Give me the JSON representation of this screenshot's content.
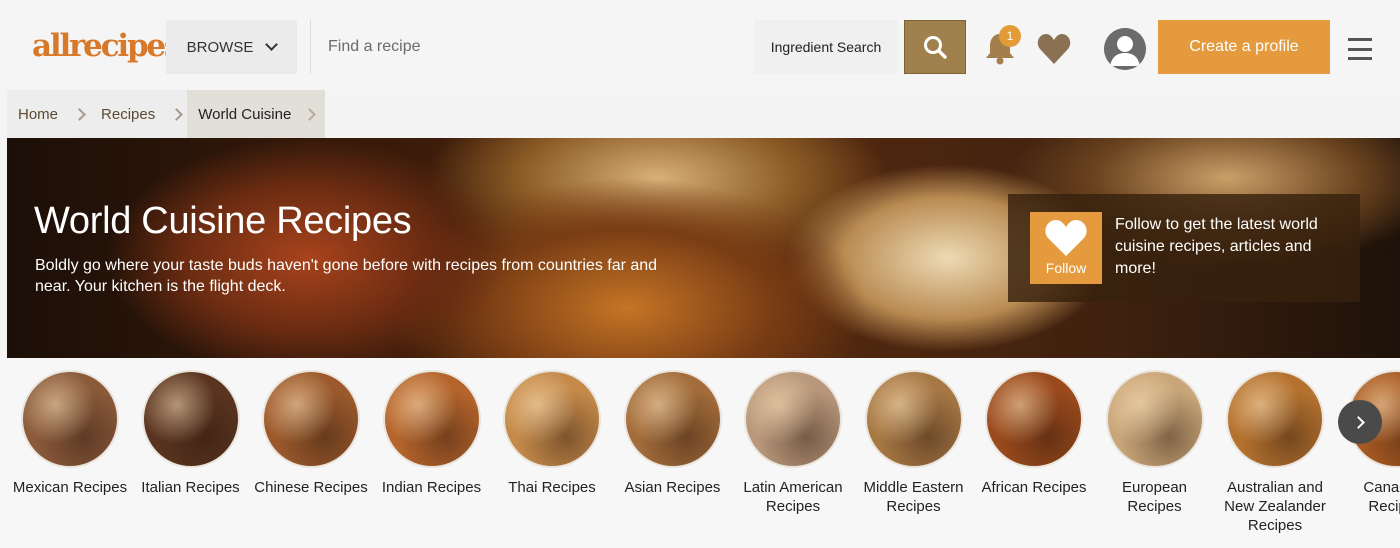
{
  "header": {
    "logo_text": "allrecipes",
    "browse_label": "BROWSE",
    "search_placeholder": "Find a recipe",
    "ingredient_search_label": "Ingredient Search",
    "notification_count": "1",
    "create_profile_label": "Create a profile",
    "brand_color": "#e49a3d"
  },
  "breadcrumb": [
    {
      "label": "Home"
    },
    {
      "label": "Recipes"
    },
    {
      "label": "World Cuisine"
    }
  ],
  "hero": {
    "title": "World Cuisine Recipes",
    "description": "Boldly go where your taste buds haven't gone before with recipes from countries far and near. Your kitchen is the flight deck.",
    "follow_label": "Follow",
    "follow_text": "Follow to get the latest world cuisine recipes, articles and more!"
  },
  "categories": [
    {
      "label": "Mexican Recipes",
      "color": "#8a5a3a"
    },
    {
      "label": "Italian Recipes",
      "color": "#5a3420"
    },
    {
      "label": "Chinese Recipes",
      "color": "#9c5a2c"
    },
    {
      "label": "Indian Recipes",
      "color": "#b5652c"
    },
    {
      "label": "Thai Recipes",
      "color": "#c58a4a"
    },
    {
      "label": "Asian Recipes",
      "color": "#a36c3a"
    },
    {
      "label": "Latin American Recipes",
      "color": "#b8977a"
    },
    {
      "label": "Middle Eastern Recipes",
      "color": "#a77844"
    },
    {
      "label": "African Recipes",
      "color": "#9a4a1c"
    },
    {
      "label": "European Recipes",
      "color": "#c9a679"
    },
    {
      "label": "Australian and New Zealander Recipes",
      "color": "#b5722f"
    },
    {
      "label": "Canadian Recipes",
      "color": "#a85a22"
    }
  ]
}
